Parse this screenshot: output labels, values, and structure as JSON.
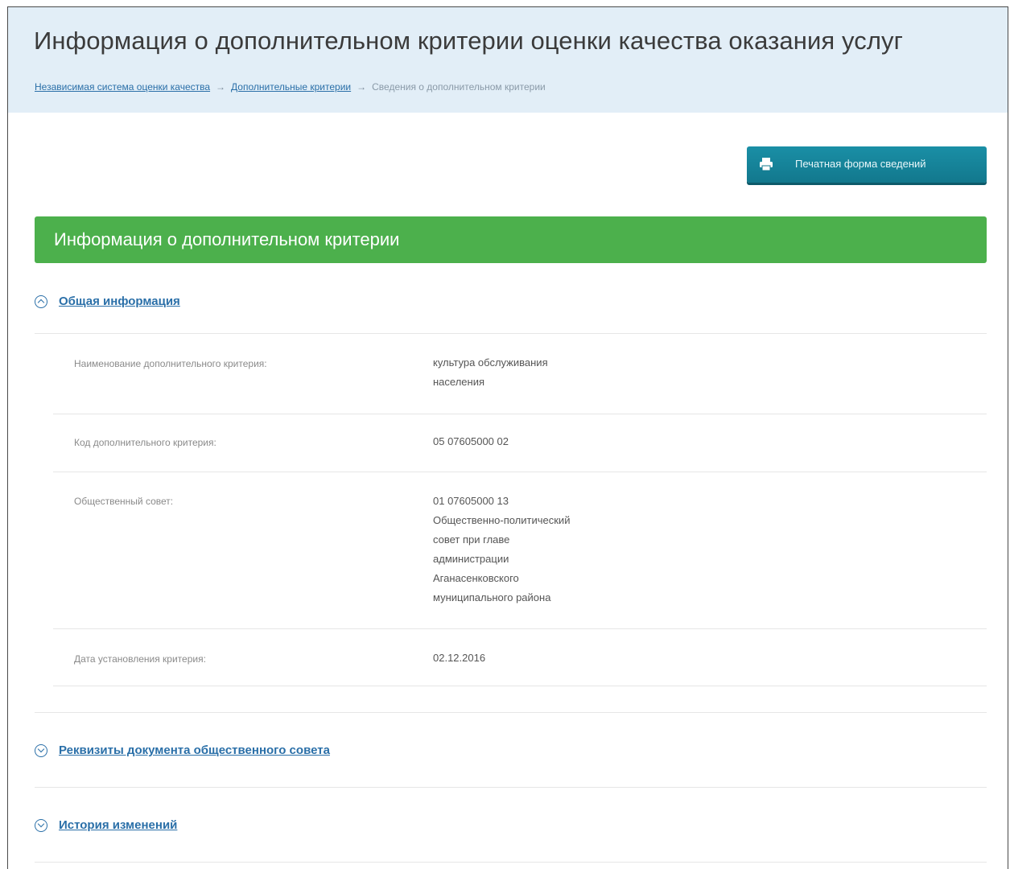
{
  "header": {
    "title": "Информация о дополнительном критерии оценки качества оказания услуг",
    "breadcrumb": [
      {
        "label": "Независимая система оценки качества",
        "link": true
      },
      {
        "label": "Дополнительные критерии",
        "link": true
      },
      {
        "label": "Сведения о дополнительном критерии",
        "link": false
      }
    ],
    "separator": "→"
  },
  "toolbar": {
    "print_label": "Печатная форма сведений",
    "print_icon": "printer-icon"
  },
  "section": {
    "title": "Информация о дополнительном критерии"
  },
  "general": {
    "label": "Общая информация",
    "icon": "chevron-up-circle-icon",
    "fields": [
      {
        "label": "Наименование дополнительного критерия:",
        "value_lines": [
          "культура обслуживания",
          "населения"
        ]
      },
      {
        "label": "Код дополнительного критерия:",
        "value_lines": [
          "05 07605000 02"
        ]
      },
      {
        "label": "Общественный совет:",
        "value_lines": [
          "01 07605000 13",
          "Общественно-политический",
          "совет при главе",
          "администрации",
          "Аганасенковского",
          "муниципального района"
        ]
      },
      {
        "label": "Дата установления критерия:",
        "value_lines": [
          "02.12.2016"
        ]
      }
    ]
  },
  "requisites": {
    "label": "Реквизиты документа общественного совета",
    "icon": "chevron-down-circle-icon"
  },
  "history": {
    "label": "История изменений",
    "icon": "chevron-down-circle-icon"
  },
  "colors": {
    "header_bg": "#e2eef7",
    "link": "#2a6fa8",
    "button": "#1a8fa6",
    "section_bar": "#4cb04c"
  }
}
